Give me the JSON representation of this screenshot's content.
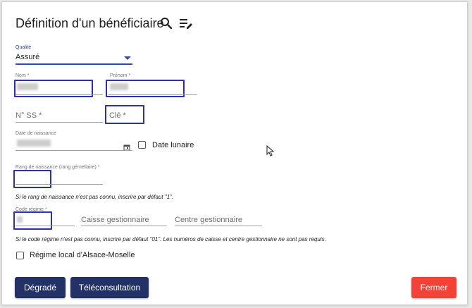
{
  "dialog": {
    "title": "Définition d'un bénéficiaire"
  },
  "qualite": {
    "label": "Qualité",
    "value": "Assuré"
  },
  "nom": {
    "label": "Nom *"
  },
  "prenom": {
    "label": "Prénom *"
  },
  "nss": {
    "placeholder": "N° SS *"
  },
  "cle": {
    "placeholder": "Clé *"
  },
  "naissance": {
    "label": "Date de naissance"
  },
  "date_lunaire": {
    "label": "Date lunaire"
  },
  "rang": {
    "label": "Rang de naissance (rang gémellaire) *",
    "hint": "Si le rang de naissance n'est pas connu, inscrire par défaut \"1\"."
  },
  "regime": {
    "label": "Code régime *",
    "caisse_placeholder": "Caisse gestionnaire",
    "centre_placeholder": "Centre gestionnaire",
    "hint": "Si le code régime n'est pas connu, inscrire par défaut \"01\". Les numéros de caisse et centre gestionnaire ne sont pas requis."
  },
  "alsace": {
    "label": "Régime local d'Alsace-Moselle"
  },
  "buttons": {
    "degrade": "Dégradé",
    "teleconsultation": "Téléconsultation",
    "fermer": "Fermer"
  },
  "colors": {
    "primary": "#223266",
    "danger": "#f44336",
    "highlight": "#2b2fb8"
  },
  "icons": {
    "search": "search-icon",
    "edit_list": "edit-list-icon",
    "calendar": "calendar-icon"
  }
}
